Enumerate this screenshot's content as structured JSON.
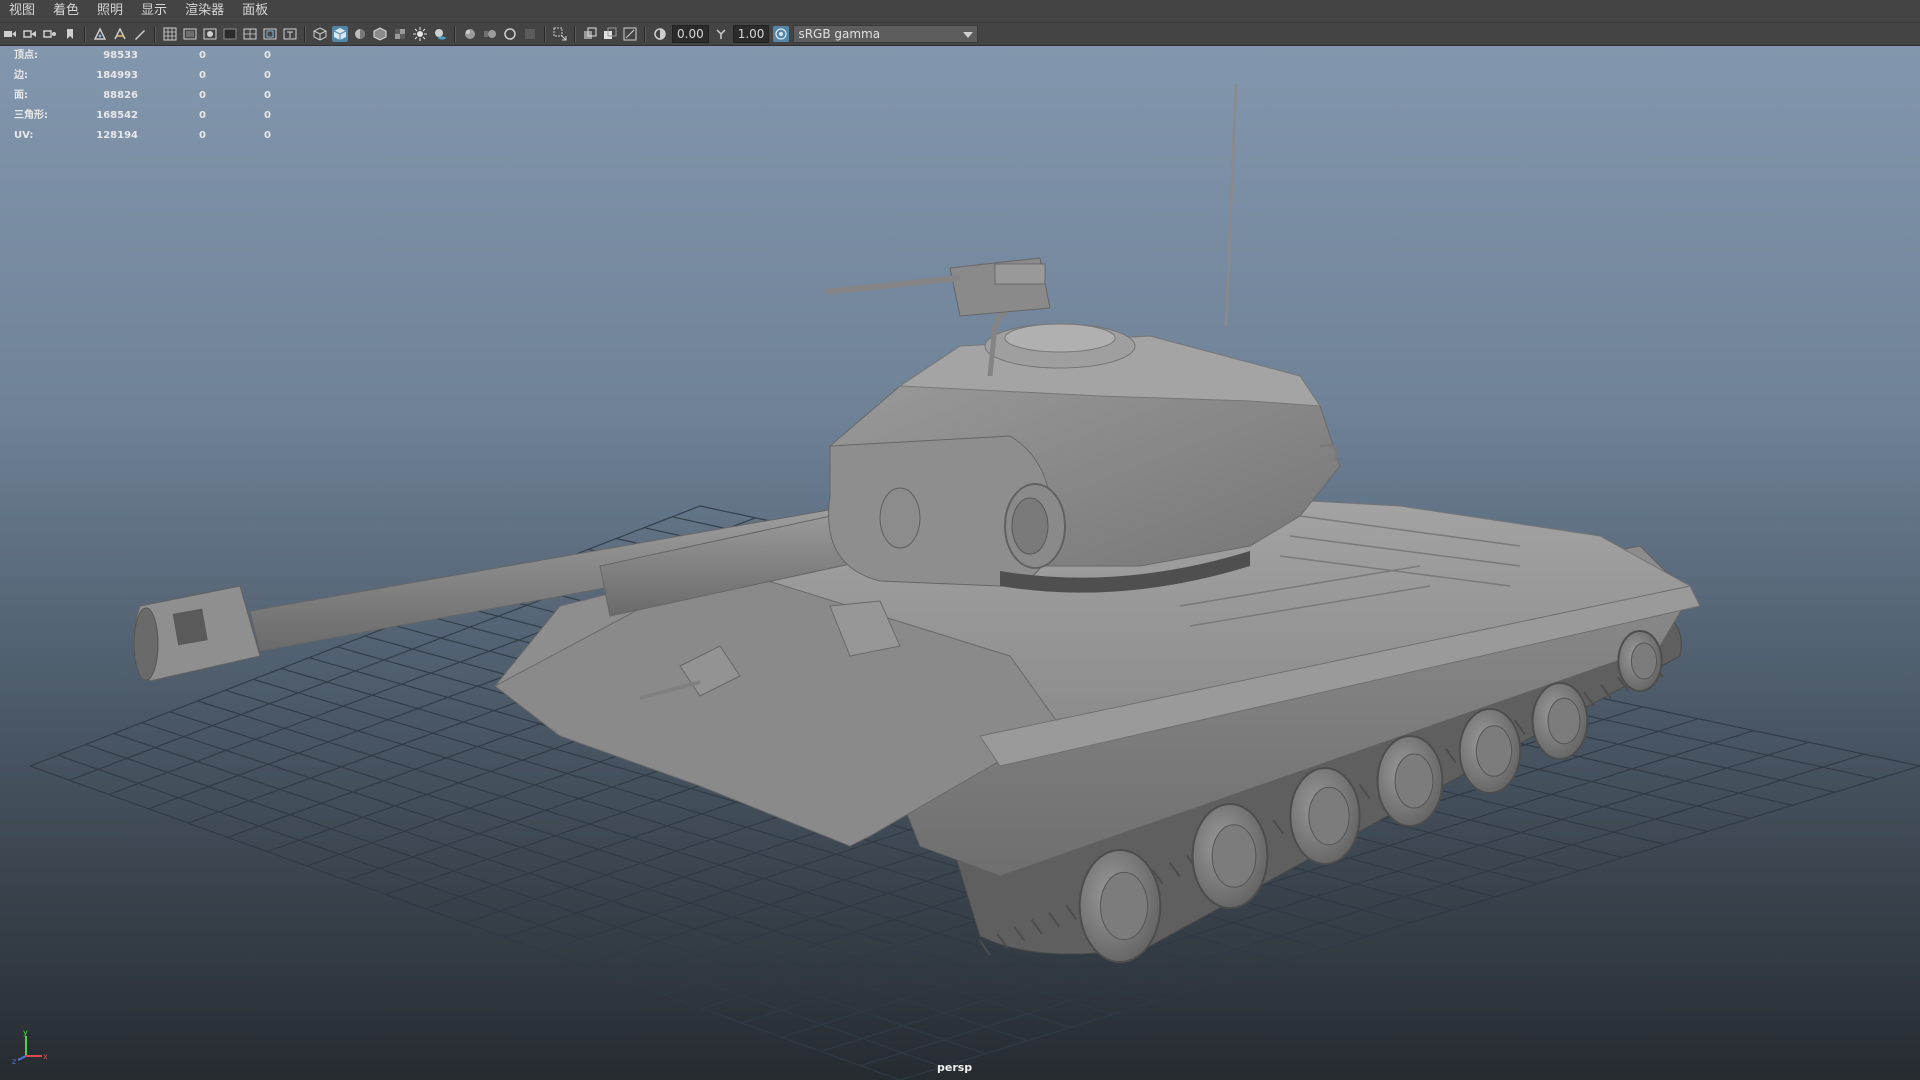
{
  "menu": {
    "items": [
      "视图",
      "着色",
      "照明",
      "显示",
      "渲染器",
      "面板"
    ]
  },
  "toolbar": {
    "exposure_value": "0.00",
    "gamma_value": "1.00",
    "color_space": "sRGB gamma",
    "icons": [
      "camera-select-icon",
      "camera-attributes-icon",
      "bookmark-icon",
      "image-plane-icon",
      "2d-pan-zoom-icon",
      "grease-pencil-icon",
      "grid-icon",
      "film-gate-icon",
      "resolution-gate-icon",
      "gate-mask-icon",
      "field-chart-icon",
      "safe-action-icon",
      "safe-title-icon",
      "wireframe-icon",
      "smooth-shade-icon",
      "default-material-icon",
      "wireframe-on-shaded-icon",
      "textured-icon",
      "use-all-lights-icon",
      "shadows-icon",
      "screen-space-ao-icon",
      "motion-blur-icon",
      "multisample-aa-icon",
      "depth-of-field-icon",
      "isolate-select-icon",
      "xray-icon",
      "xray-active-components-icon",
      "xray-joints-icon",
      "exposure-icon",
      "gamma-icon",
      "color-management-icon"
    ],
    "active_icons": [
      "smooth-shade-icon",
      "color-management-icon"
    ]
  },
  "hud": {
    "rows": [
      {
        "label": "顶点:",
        "v1": "98533",
        "v2": "0",
        "v3": "0"
      },
      {
        "label": "边:",
        "v1": "184993",
        "v2": "0",
        "v3": "0"
      },
      {
        "label": "面:",
        "v1": "88826",
        "v2": "0",
        "v3": "0"
      },
      {
        "label": "三角形:",
        "v1": "168542",
        "v2": "0",
        "v3": "0"
      },
      {
        "label": "UV:",
        "v1": "128194",
        "v2": "0",
        "v3": "0"
      }
    ]
  },
  "viewport": {
    "camera": "persp",
    "axis_labels": {
      "x": "x",
      "y": "y",
      "z": "z"
    },
    "colors": {
      "model": "#8a8a8a",
      "grid": "#2e3944",
      "selection": "#5285a6"
    }
  }
}
